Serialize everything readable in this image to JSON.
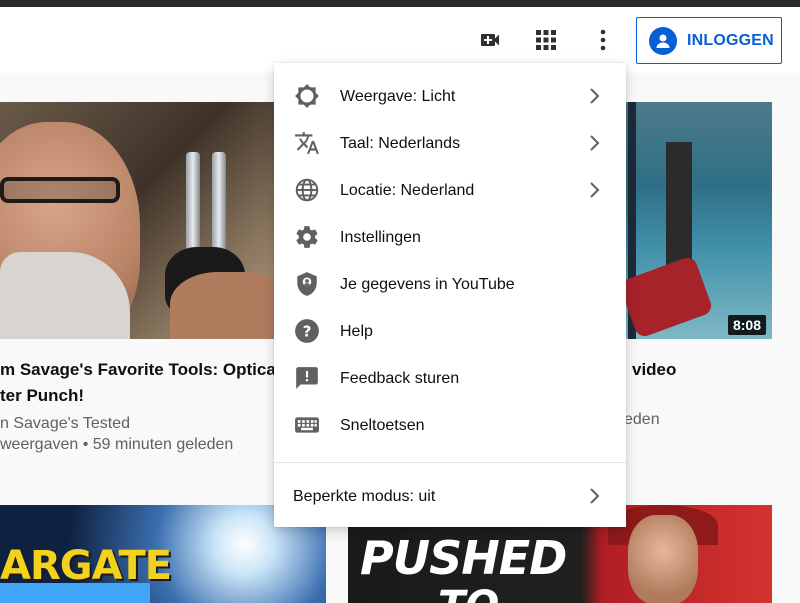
{
  "masthead": {
    "signin_label": "INLOGGEN"
  },
  "menu": {
    "items": [
      {
        "label": "Weergave: Licht",
        "icon": "appearance-icon",
        "submenu": true
      },
      {
        "label": "Taal: Nederlands",
        "icon": "translate-icon",
        "submenu": true
      },
      {
        "label": "Locatie: Nederland",
        "icon": "globe-icon",
        "submenu": true
      },
      {
        "label": "Instellingen",
        "icon": "gear-icon",
        "submenu": false
      },
      {
        "label": "Je gegevens in YouTube",
        "icon": "shield-person-icon",
        "submenu": false
      },
      {
        "label": "Help",
        "icon": "help-icon",
        "submenu": false
      },
      {
        "label": "Feedback sturen",
        "icon": "feedback-icon",
        "submenu": false
      },
      {
        "label": "Sneltoetsen",
        "icon": "keyboard-icon",
        "submenu": false
      }
    ],
    "restricted": {
      "label": "Beperkte modus: uit",
      "submenu": true
    }
  },
  "videos": [
    {
      "title_line1": "m Savage's Favorite Tools: Optica",
      "title_line2": "ter Punch!",
      "channel": "n Savage's Tested",
      "stats": "weergaven • 59 minuten geleden"
    },
    {
      "title_line1": "video",
      "meta_tail": "eden",
      "duration": "8:08"
    }
  ],
  "thumbnails": {
    "bottom_left_text": "ARGATE",
    "bottom_right_text_1": "PUSHED",
    "bottom_right_text_2": "TO"
  },
  "colors": {
    "accent": "#065fd4",
    "icon_grey": "#606060",
    "text": "#0f0f0f"
  }
}
